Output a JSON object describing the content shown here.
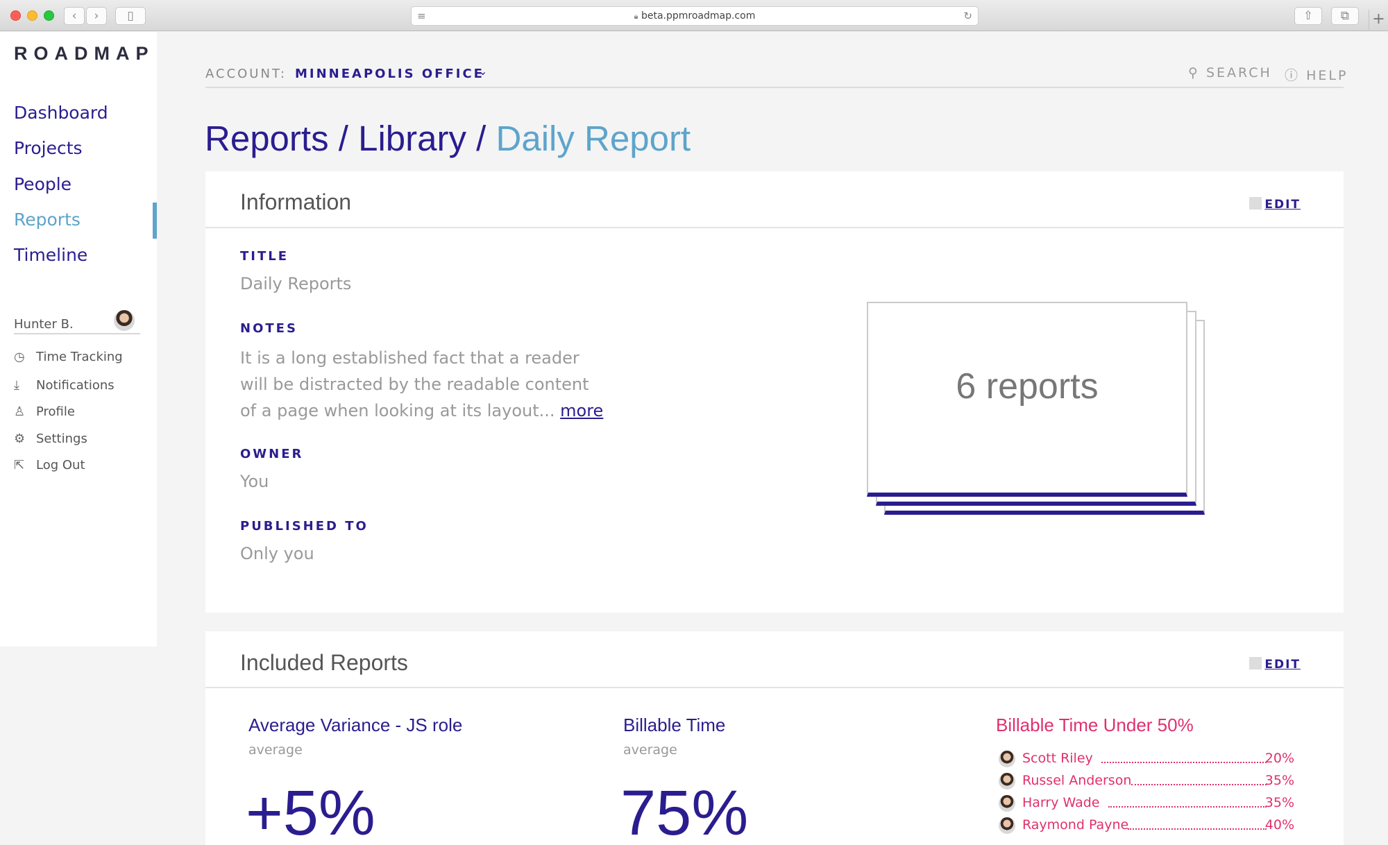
{
  "browser": {
    "url": "beta.ppmroadmap.com"
  },
  "sidebar": {
    "logo": "ROADMAP",
    "nav": [
      "Dashboard",
      "Projects",
      "People",
      "Reports",
      "Timeline"
    ],
    "active": "Reports",
    "user": "Hunter B.",
    "menu": [
      "Time Tracking",
      "Notifications",
      "Profile",
      "Settings",
      "Log Out"
    ]
  },
  "topbar": {
    "account_label": "ACCOUNT:",
    "account_value": "MINNEAPOLIS OFFICE",
    "search": "SEARCH",
    "help": "HELP"
  },
  "breadcrumb": {
    "parts": [
      "Reports",
      "Library"
    ],
    "separator": "/",
    "current": "Daily Report"
  },
  "info_card": {
    "title": "Information",
    "edit": "EDIT",
    "title_label": "TITLE",
    "title_value": "Daily Reports",
    "notes_label": "NOTES",
    "notes_text": "It is a long established fact that a reader will be distracted by the readable content of a page when looking at its layout...",
    "notes_more": "more",
    "owner_label": "OWNER",
    "owner_value": "You",
    "published_label": "PUBLISHED TO",
    "published_value": "Only you",
    "stack_text": "6 reports"
  },
  "included_card": {
    "title": "Included Reports",
    "edit": "EDIT",
    "metrics": [
      {
        "title": "Average Variance - JS role",
        "sub": "average",
        "value": "+5%"
      },
      {
        "title": "Billable Time",
        "sub": "average",
        "value": "75%"
      }
    ],
    "under": {
      "title": "Billable Time Under 50%",
      "people": [
        {
          "name": "Scott Riley",
          "pct": "20%"
        },
        {
          "name": "Russel Anderson",
          "pct": "35%"
        },
        {
          "name": "Harry Wade",
          "pct": "35%"
        },
        {
          "name": "Raymond Payne",
          "pct": "40%"
        }
      ]
    }
  },
  "colors": {
    "primary": "#2a1d8f",
    "accent": "#5ea4cb",
    "alert": "#e0306e"
  }
}
